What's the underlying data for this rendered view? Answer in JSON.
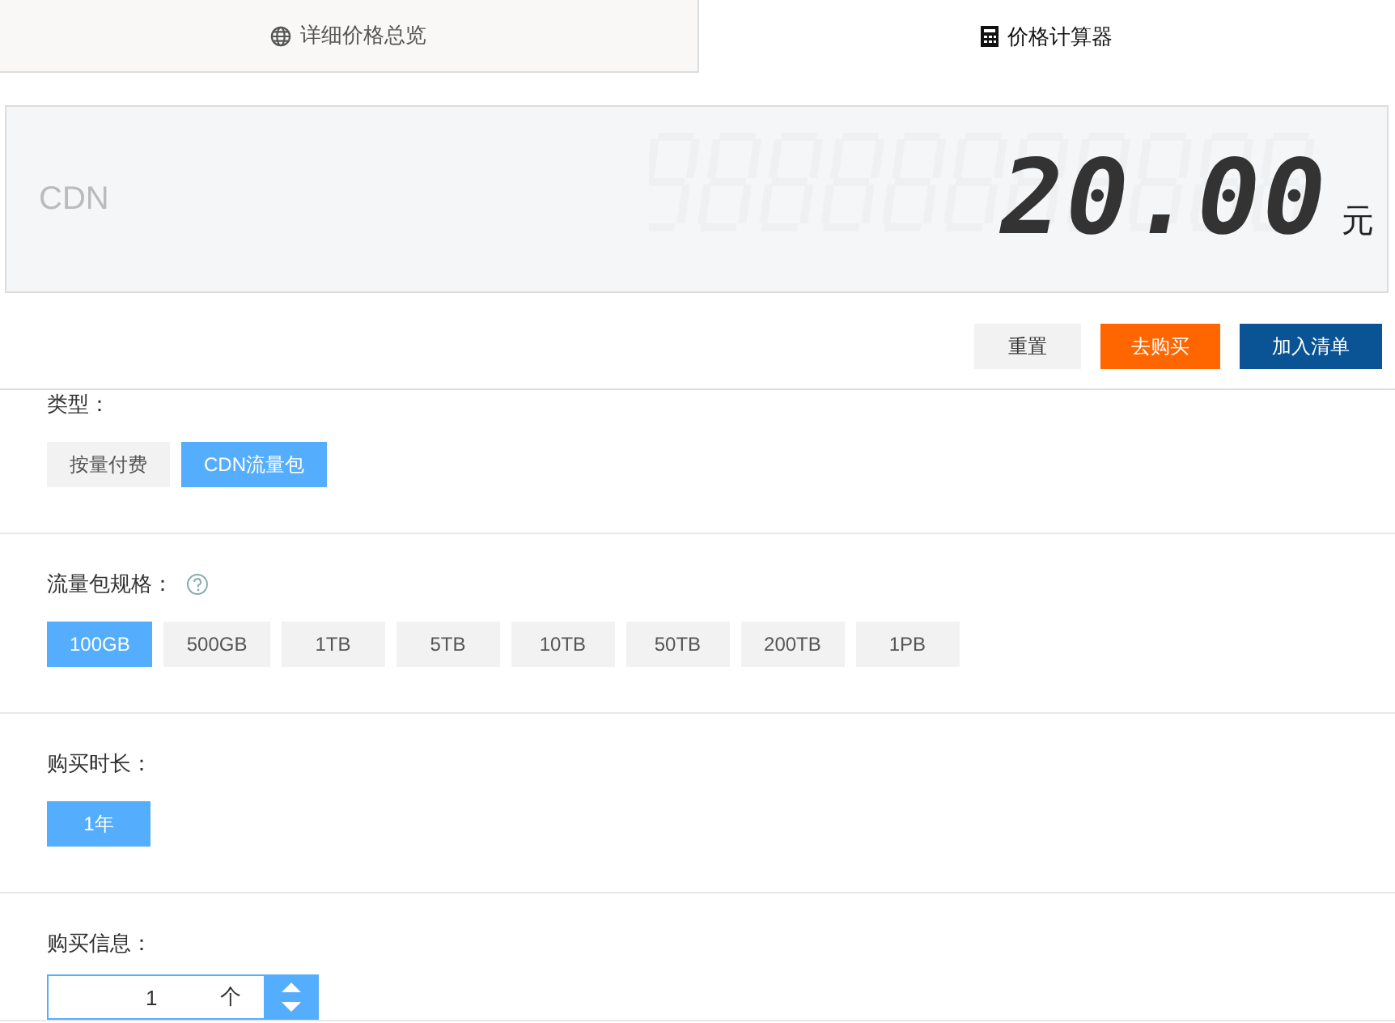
{
  "tabs": [
    {
      "label": "详细价格总览",
      "kind": "overview",
      "selected": false
    },
    {
      "label": "价格计算器",
      "kind": "calculator",
      "selected": true
    }
  ],
  "price": {
    "product": "CDN",
    "amount": "20.00",
    "unit": "元"
  },
  "actions": [
    {
      "label": "重置",
      "kind": "plain"
    },
    {
      "label": "去购买",
      "kind": "buy"
    },
    {
      "label": "加入清单",
      "kind": "cart"
    }
  ],
  "sections": [
    {
      "label": "类型：",
      "kind": "options",
      "options": [
        {
          "label": "按量付费",
          "selected": false
        },
        {
          "label": "CDN流量包",
          "selected": true
        }
      ]
    },
    {
      "label": "流量包规格：",
      "kind": "options",
      "help": true,
      "options": [
        {
          "label": "100GB",
          "selected": true
        },
        {
          "label": "500GB",
          "selected": false
        },
        {
          "label": "1TB",
          "selected": false
        },
        {
          "label": "5TB",
          "selected": false
        },
        {
          "label": "10TB",
          "selected": false
        },
        {
          "label": "50TB",
          "selected": false
        },
        {
          "label": "200TB",
          "selected": false
        },
        {
          "label": "1PB",
          "selected": false
        }
      ]
    },
    {
      "label": "购买时长：",
      "kind": "options",
      "options": [
        {
          "label": "1年",
          "selected": true
        }
      ]
    },
    {
      "label": "购买信息：",
      "kind": "quantity",
      "value": "1",
      "unit": "个"
    }
  ]
}
